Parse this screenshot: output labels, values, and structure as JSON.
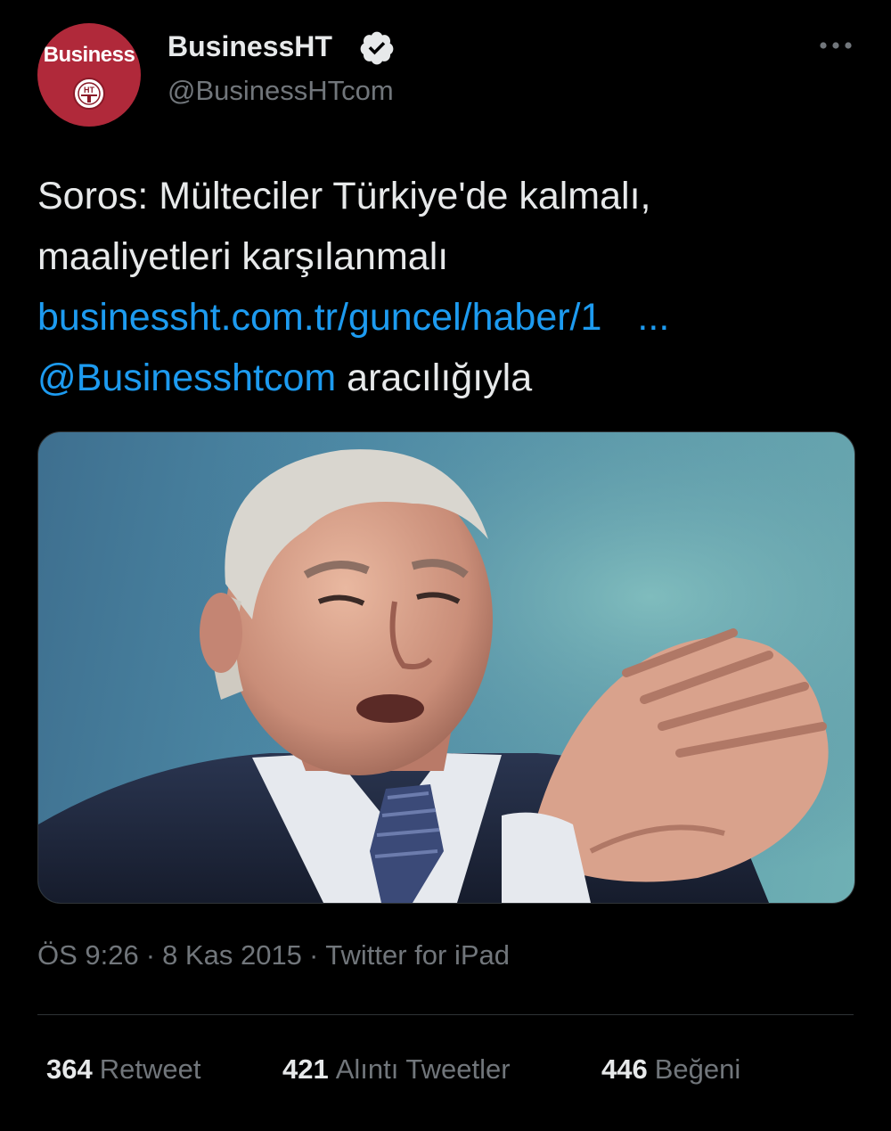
{
  "colors": {
    "background": "#000000",
    "text": "#e7e9ea",
    "secondary_text": "#71767b",
    "link": "#1d9bf0",
    "divider": "#2f3336",
    "avatar_bg": "#b0293a"
  },
  "author": {
    "display_name": "BusinessHT",
    "handle": "@BusinessHTcom",
    "verified": true,
    "avatar_logo_text": "Business",
    "avatar_emblem_text": "HT"
  },
  "header": {
    "more_icon": "more-horizontal-icon"
  },
  "tweet": {
    "text_line1": "Soros: Mülteciler Türkiye'de kalmalı,",
    "text_line2": "maaliyetleri karşılanmalı",
    "link_text": "businessht.com.tr/guncel/haber/1",
    "link_ellipsis": "...",
    "mention": "@Businesshtcom",
    "mention_suffix": " aracılığıyla"
  },
  "media": {
    "type": "photo"
  },
  "meta": {
    "time": "ÖS 9:26",
    "separator": "·",
    "date": "8 Kas 2015",
    "source": "Twitter for iPad"
  },
  "stats": {
    "retweets_count": "364",
    "retweets_label": "Retweet",
    "quotes_count": "421",
    "quotes_label": "Alıntı Tweetler",
    "likes_count": "446",
    "likes_label": "Beğeni"
  }
}
